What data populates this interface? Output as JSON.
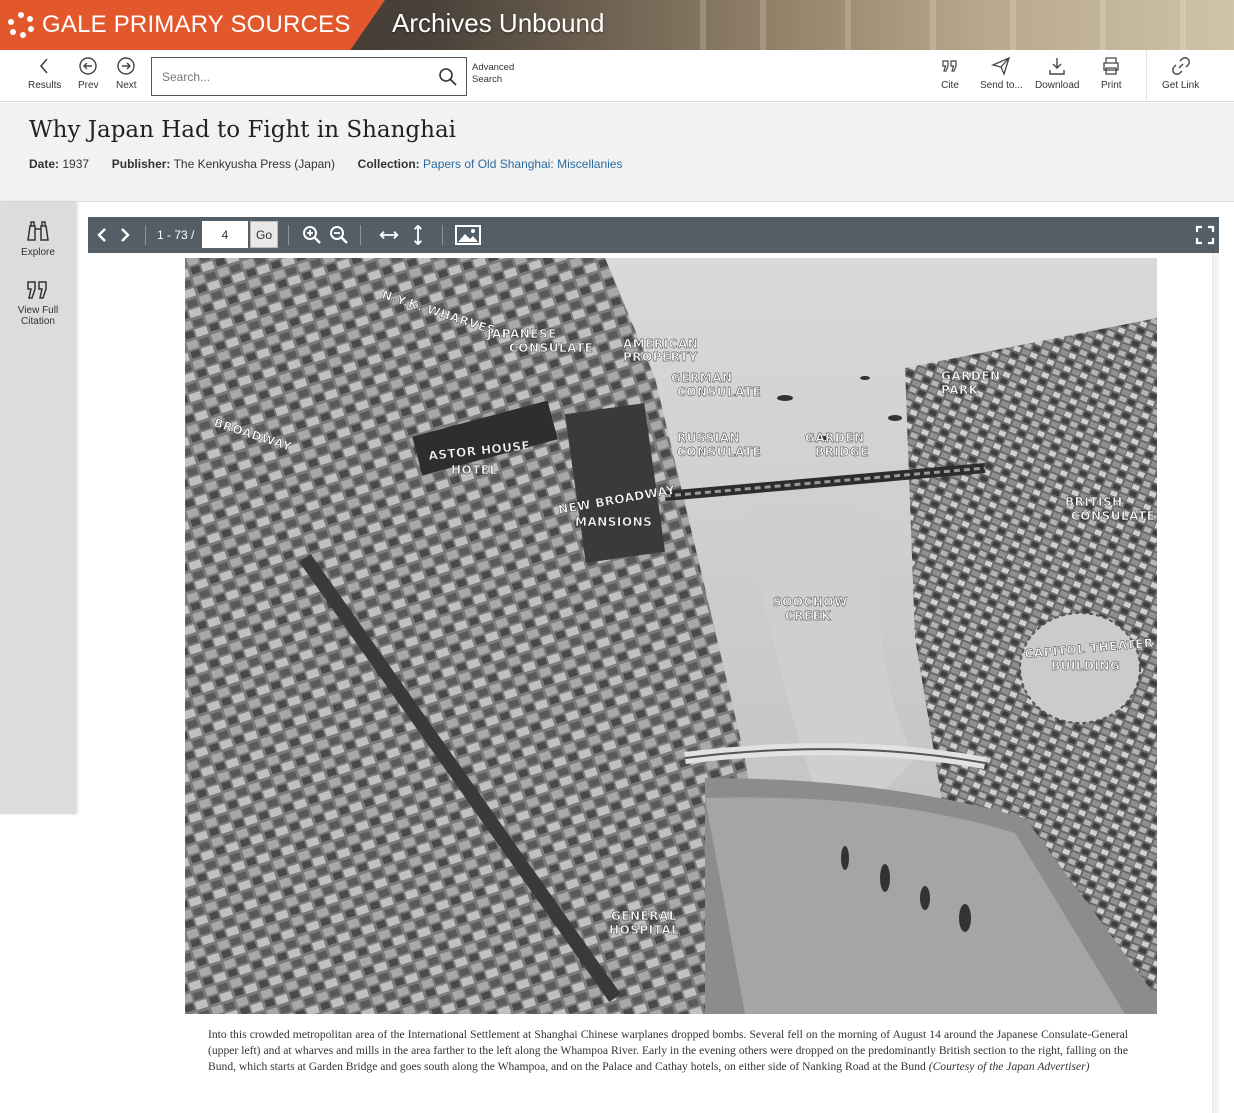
{
  "banner": {
    "brand": "GALE PRIMARY SOURCES",
    "product": "Archives Unbound",
    "brand_color": "#e2582c"
  },
  "toolbar": {
    "results": "Results",
    "prev": "Prev",
    "next": "Next",
    "search_placeholder": "Search...",
    "advanced_search_line1": "Advanced",
    "advanced_search_line2": "Search",
    "cite": "Cite",
    "send_to": "Send to...",
    "download": "Download",
    "print": "Print",
    "get_link": "Get Link"
  },
  "document": {
    "title": "Why Japan Had to Fight in Shanghai",
    "date_label": "Date:",
    "date": "1937",
    "publisher_label": "Publisher:",
    "publisher": "The Kenkyusha Press (Japan)",
    "collection_label": "Collection:",
    "collection": "Papers of Old Shanghai: Miscellanies",
    "link_color": "#2b6aa0"
  },
  "left_rail": {
    "explore": "Explore",
    "citation_line1": "View Full",
    "citation_line2": "Citation"
  },
  "viewer": {
    "page_range": "1 - 73 /",
    "current_page": "4",
    "go": "Go",
    "bar_color": "#535e66"
  },
  "image": {
    "labels": {
      "wharves": "N.Y.K. WHARVES",
      "japanese_consulate_1": "JAPANESE",
      "japanese_consulate_2": "CONSULATE",
      "american_property_1": "AMERICAN",
      "american_property_2": "PROPERTY",
      "german_consulate_1": "GERMAN",
      "german_consulate_2": "CONSULATE",
      "garden_park_1": "GARDEN",
      "garden_park_2": "PARK",
      "russian_consulate_1": "RUSSIAN",
      "russian_consulate_2": "CONSULATE",
      "garden_bridge_1": "GARDEN",
      "garden_bridge_2": "BRIDGE",
      "broadway": "BROADWAY",
      "astor_house_1": "ASTOR HOUSE",
      "astor_house_2": "HOTEL",
      "new_broadway_1": "NEW BROADWAY",
      "new_broadway_2": "MANSIONS",
      "british_consulate_1": "BRITISH",
      "british_consulate_2": "CONSULATE",
      "soochow_creek_1": "SOOCHOW",
      "soochow_creek_2": "CREEK",
      "capitol_theater_1": "CAPITOL THEATER",
      "capitol_theater_2": "BUILDING",
      "general_hospital_1": "GENERAL",
      "general_hospital_2": "HOSPITAL"
    },
    "caption": "Into this crowded metropolitan area of the International Settlement at Shanghai Chinese warplanes dropped bombs. Several fell on the morning of August 14 around the Japanese Consulate-General (upper left) and at wharves and mills in the area farther to the left along the Whampoa River. Early in the evening others were dropped on the predominantly British section to the right, falling on the Bund, which starts at Garden Bridge and goes south along the Whampoa, and on the Palace and Cathay hotels, on either side of Nanking Road at the Bund",
    "caption_credit": "(Courtesy of the Japan Advertiser)"
  }
}
